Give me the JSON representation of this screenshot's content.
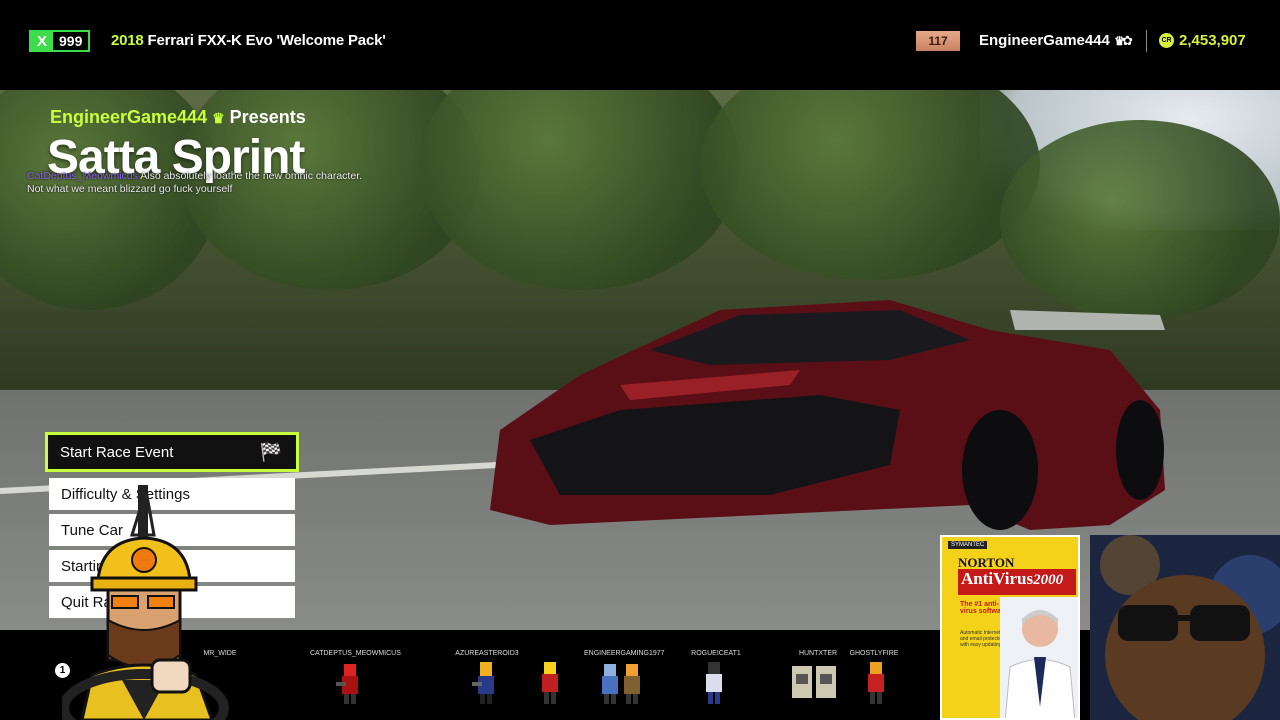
{
  "header": {
    "xp_letter": "X",
    "xp_level": "999",
    "car_year": "2018",
    "car_name": "Ferrari FXX-K Evo 'Welcome Pack'",
    "rank": "117",
    "gamertag": "EngineerGame444",
    "crown_glyph": "♛",
    "settings_glyph": "✿",
    "credits_icon": "CR",
    "credits": "2,453,907"
  },
  "event": {
    "presenter": "EngineerGame444",
    "presenter_crown": "♛",
    "presents_label": "Presents",
    "title": "Satta Sprint"
  },
  "chat": {
    "username": "CatDeptus_Meowmicus",
    "message": "Also absolutely loathe the new omnic character. Not what we meant blizzard go fuck yourself"
  },
  "menu": {
    "items": [
      {
        "label": "Start Race Event",
        "icon": "checkered-flag-icon"
      },
      {
        "label": "Difficulty & Settings"
      },
      {
        "label": "Tune Car"
      },
      {
        "label": "Starting"
      },
      {
        "label": "Quit Ra"
      }
    ]
  },
  "overlay": {
    "viewer_number": "1",
    "viewers": [
      "MR_WIDE",
      "CATDEPTUS_MEOWMICUS",
      "AZUREASTEROID3",
      "ENGINEERGAMING1977",
      "ROGUEICEAT1",
      "HUNTXTER",
      "GHOSTLYFIRE"
    ]
  },
  "boxart": {
    "brand": "SYMANTEC",
    "product": "NORTON",
    "title": "AntiVirus",
    "year": "2000",
    "tagline": "The #1 anti-virus software",
    "description": "Automatic Internet and email protection with easy updating"
  },
  "colors": {
    "accent_green": "#c8ff3c",
    "xp_green": "#3ddc4a",
    "credits_yellow": "#d8f03a",
    "rank_copper": "#d9916f"
  }
}
